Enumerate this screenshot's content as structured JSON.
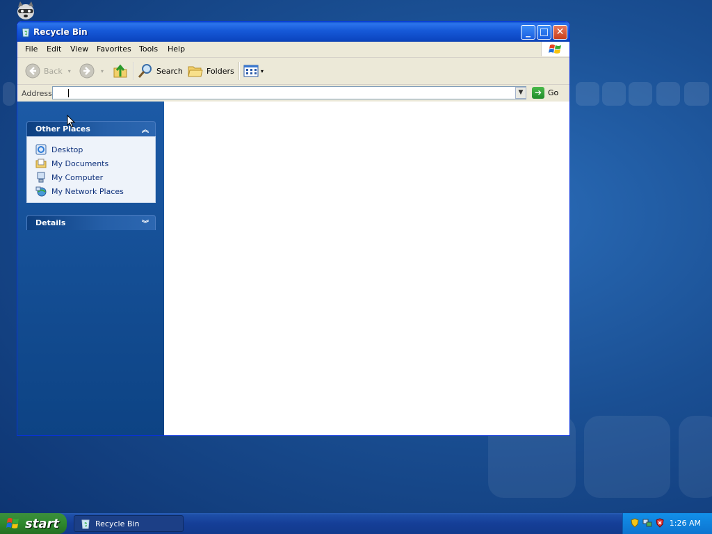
{
  "window": {
    "title": "Recycle Bin",
    "minimize_label": "_",
    "maximize_label": "□",
    "close_label": "✕"
  },
  "menu": {
    "items": [
      "File",
      "Edit",
      "View",
      "Favorites",
      "Tools",
      "Help"
    ]
  },
  "toolbar": {
    "back_label": "Back",
    "search_label": "Search",
    "folders_label": "Folders"
  },
  "address": {
    "label": "Address",
    "value": "",
    "go_label": "Go"
  },
  "left_pane": {
    "other_places": {
      "title": "Other Places",
      "items": [
        "Desktop",
        "My Documents",
        "My Computer",
        "My Network Places"
      ]
    },
    "details": {
      "title": "Details"
    }
  },
  "taskbar": {
    "start_label": "start",
    "task_item_label": "Recycle Bin",
    "clock": "1:26 AM"
  }
}
